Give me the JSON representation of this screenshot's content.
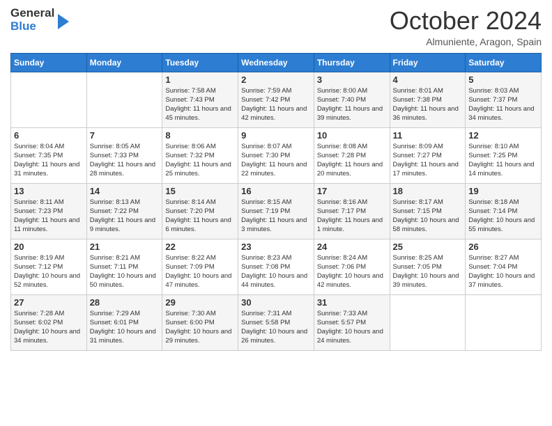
{
  "header": {
    "logo_general": "General",
    "logo_blue": "Blue",
    "month_title": "October 2024",
    "location": "Almuniente, Aragon, Spain"
  },
  "days_of_week": [
    "Sunday",
    "Monday",
    "Tuesday",
    "Wednesday",
    "Thursday",
    "Friday",
    "Saturday"
  ],
  "weeks": [
    [
      {
        "day": "",
        "sunrise": "",
        "sunset": "",
        "daylight": ""
      },
      {
        "day": "",
        "sunrise": "",
        "sunset": "",
        "daylight": ""
      },
      {
        "day": "1",
        "sunrise": "Sunrise: 7:58 AM",
        "sunset": "Sunset: 7:43 PM",
        "daylight": "Daylight: 11 hours and 45 minutes."
      },
      {
        "day": "2",
        "sunrise": "Sunrise: 7:59 AM",
        "sunset": "Sunset: 7:42 PM",
        "daylight": "Daylight: 11 hours and 42 minutes."
      },
      {
        "day": "3",
        "sunrise": "Sunrise: 8:00 AM",
        "sunset": "Sunset: 7:40 PM",
        "daylight": "Daylight: 11 hours and 39 minutes."
      },
      {
        "day": "4",
        "sunrise": "Sunrise: 8:01 AM",
        "sunset": "Sunset: 7:38 PM",
        "daylight": "Daylight: 11 hours and 36 minutes."
      },
      {
        "day": "5",
        "sunrise": "Sunrise: 8:03 AM",
        "sunset": "Sunset: 7:37 PM",
        "daylight": "Daylight: 11 hours and 34 minutes."
      }
    ],
    [
      {
        "day": "6",
        "sunrise": "Sunrise: 8:04 AM",
        "sunset": "Sunset: 7:35 PM",
        "daylight": "Daylight: 11 hours and 31 minutes."
      },
      {
        "day": "7",
        "sunrise": "Sunrise: 8:05 AM",
        "sunset": "Sunset: 7:33 PM",
        "daylight": "Daylight: 11 hours and 28 minutes."
      },
      {
        "day": "8",
        "sunrise": "Sunrise: 8:06 AM",
        "sunset": "Sunset: 7:32 PM",
        "daylight": "Daylight: 11 hours and 25 minutes."
      },
      {
        "day": "9",
        "sunrise": "Sunrise: 8:07 AM",
        "sunset": "Sunset: 7:30 PM",
        "daylight": "Daylight: 11 hours and 22 minutes."
      },
      {
        "day": "10",
        "sunrise": "Sunrise: 8:08 AM",
        "sunset": "Sunset: 7:28 PM",
        "daylight": "Daylight: 11 hours and 20 minutes."
      },
      {
        "day": "11",
        "sunrise": "Sunrise: 8:09 AM",
        "sunset": "Sunset: 7:27 PM",
        "daylight": "Daylight: 11 hours and 17 minutes."
      },
      {
        "day": "12",
        "sunrise": "Sunrise: 8:10 AM",
        "sunset": "Sunset: 7:25 PM",
        "daylight": "Daylight: 11 hours and 14 minutes."
      }
    ],
    [
      {
        "day": "13",
        "sunrise": "Sunrise: 8:11 AM",
        "sunset": "Sunset: 7:23 PM",
        "daylight": "Daylight: 11 hours and 11 minutes."
      },
      {
        "day": "14",
        "sunrise": "Sunrise: 8:13 AM",
        "sunset": "Sunset: 7:22 PM",
        "daylight": "Daylight: 11 hours and 9 minutes."
      },
      {
        "day": "15",
        "sunrise": "Sunrise: 8:14 AM",
        "sunset": "Sunset: 7:20 PM",
        "daylight": "Daylight: 11 hours and 6 minutes."
      },
      {
        "day": "16",
        "sunrise": "Sunrise: 8:15 AM",
        "sunset": "Sunset: 7:19 PM",
        "daylight": "Daylight: 11 hours and 3 minutes."
      },
      {
        "day": "17",
        "sunrise": "Sunrise: 8:16 AM",
        "sunset": "Sunset: 7:17 PM",
        "daylight": "Daylight: 11 hours and 1 minute."
      },
      {
        "day": "18",
        "sunrise": "Sunrise: 8:17 AM",
        "sunset": "Sunset: 7:15 PM",
        "daylight": "Daylight: 10 hours and 58 minutes."
      },
      {
        "day": "19",
        "sunrise": "Sunrise: 8:18 AM",
        "sunset": "Sunset: 7:14 PM",
        "daylight": "Daylight: 10 hours and 55 minutes."
      }
    ],
    [
      {
        "day": "20",
        "sunrise": "Sunrise: 8:19 AM",
        "sunset": "Sunset: 7:12 PM",
        "daylight": "Daylight: 10 hours and 52 minutes."
      },
      {
        "day": "21",
        "sunrise": "Sunrise: 8:21 AM",
        "sunset": "Sunset: 7:11 PM",
        "daylight": "Daylight: 10 hours and 50 minutes."
      },
      {
        "day": "22",
        "sunrise": "Sunrise: 8:22 AM",
        "sunset": "Sunset: 7:09 PM",
        "daylight": "Daylight: 10 hours and 47 minutes."
      },
      {
        "day": "23",
        "sunrise": "Sunrise: 8:23 AM",
        "sunset": "Sunset: 7:08 PM",
        "daylight": "Daylight: 10 hours and 44 minutes."
      },
      {
        "day": "24",
        "sunrise": "Sunrise: 8:24 AM",
        "sunset": "Sunset: 7:06 PM",
        "daylight": "Daylight: 10 hours and 42 minutes."
      },
      {
        "day": "25",
        "sunrise": "Sunrise: 8:25 AM",
        "sunset": "Sunset: 7:05 PM",
        "daylight": "Daylight: 10 hours and 39 minutes."
      },
      {
        "day": "26",
        "sunrise": "Sunrise: 8:27 AM",
        "sunset": "Sunset: 7:04 PM",
        "daylight": "Daylight: 10 hours and 37 minutes."
      }
    ],
    [
      {
        "day": "27",
        "sunrise": "Sunrise: 7:28 AM",
        "sunset": "Sunset: 6:02 PM",
        "daylight": "Daylight: 10 hours and 34 minutes."
      },
      {
        "day": "28",
        "sunrise": "Sunrise: 7:29 AM",
        "sunset": "Sunset: 6:01 PM",
        "daylight": "Daylight: 10 hours and 31 minutes."
      },
      {
        "day": "29",
        "sunrise": "Sunrise: 7:30 AM",
        "sunset": "Sunset: 6:00 PM",
        "daylight": "Daylight: 10 hours and 29 minutes."
      },
      {
        "day": "30",
        "sunrise": "Sunrise: 7:31 AM",
        "sunset": "Sunset: 5:58 PM",
        "daylight": "Daylight: 10 hours and 26 minutes."
      },
      {
        "day": "31",
        "sunrise": "Sunrise: 7:33 AM",
        "sunset": "Sunset: 5:57 PM",
        "daylight": "Daylight: 10 hours and 24 minutes."
      },
      {
        "day": "",
        "sunrise": "",
        "sunset": "",
        "daylight": ""
      },
      {
        "day": "",
        "sunrise": "",
        "sunset": "",
        "daylight": ""
      }
    ]
  ]
}
